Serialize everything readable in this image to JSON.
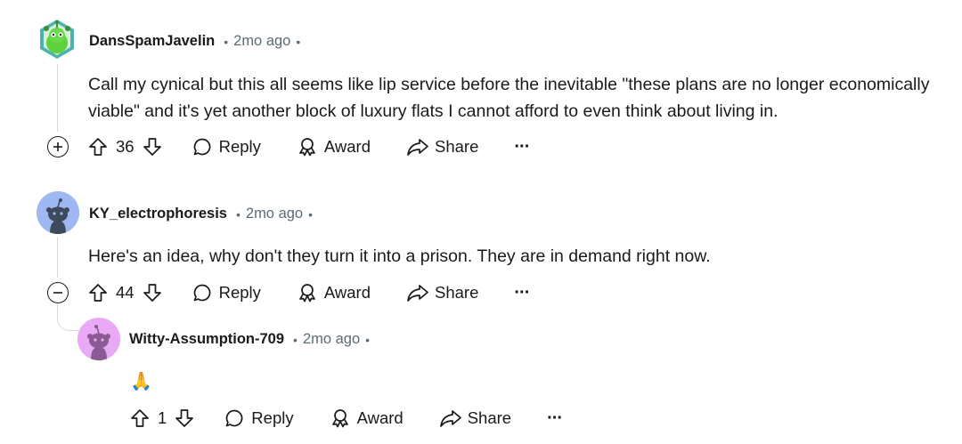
{
  "comments": [
    {
      "author": "DansSpamJavelin",
      "separator": "•",
      "time": "2mo ago",
      "trail": "•",
      "lines": [
        "Call my cynical but this all seems like lip service before the inevitable \"these plans are no longer economically",
        "viable\" and it's yet another block of luxury flats I cannot afford to even think about living in."
      ],
      "votes": "36",
      "expand_symbol": "+",
      "avatar": "snoo-green-icon"
    },
    {
      "author": "KY_electrophoresis",
      "separator": "•",
      "time": "2mo ago",
      "trail": "•",
      "lines": [
        "Here's an idea, why don't they turn it into a prison. They are in demand right now."
      ],
      "votes": "44",
      "expand_symbol": "−",
      "avatar": "snoo-blue-icon"
    },
    {
      "author": "Witty-Assumption-709",
      "separator": "•",
      "time": "2mo ago",
      "trail": "•",
      "emoji": "🙏",
      "votes": "1",
      "avatar": "snoo-pink-icon"
    }
  ],
  "actions": {
    "reply": "Reply",
    "award": "Award",
    "share": "Share",
    "more": "···"
  },
  "colors": {
    "text": "#1a1a1b",
    "meta": "#5c6c74",
    "thread_line": "#d7dadc",
    "avatar_blue": "#9fb7f2",
    "avatar_pink": "#e9a9f5"
  }
}
